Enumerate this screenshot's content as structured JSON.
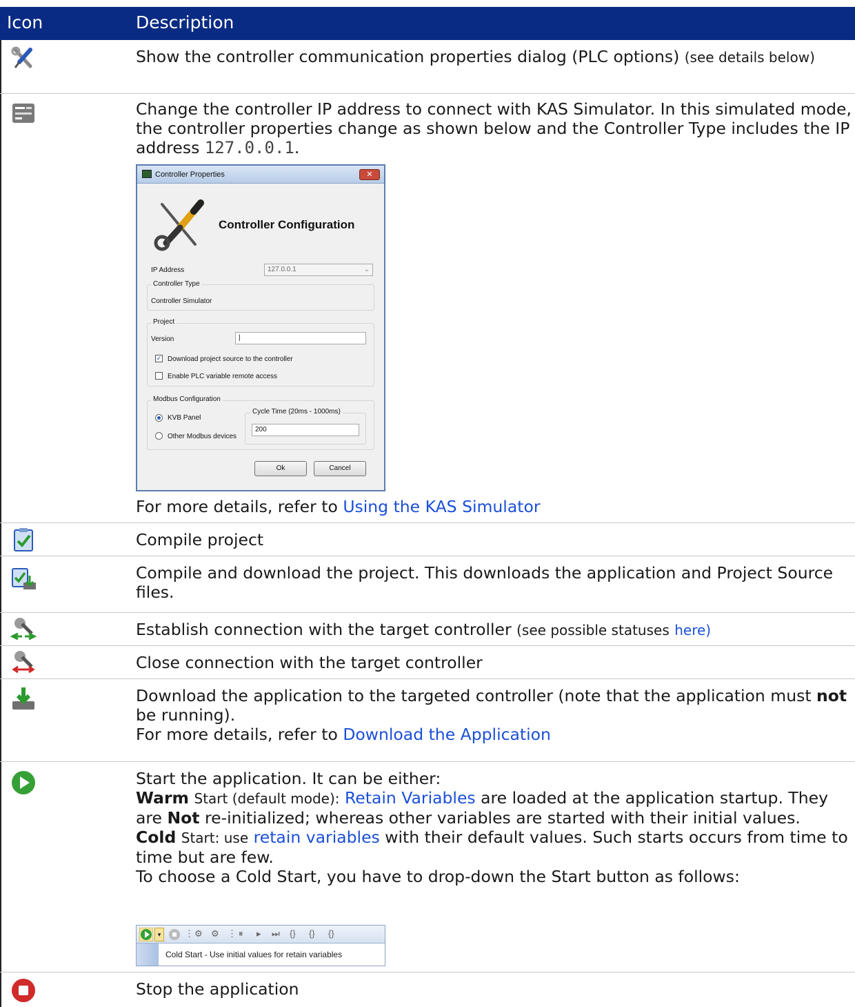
{
  "header": {
    "icon_col": "Icon",
    "desc_col": "Description"
  },
  "rows": {
    "r1": {
      "text": "Show the controller communication properties dialog (PLC options)",
      "small": "(see details below)"
    },
    "r2": {
      "text": "Change the controller IP address to connect with KAS Simulator. In this simulated mode, the controller properties change as shown below and the Controller Type includes the IP address",
      "ip": "127.0.0.1",
      "after": ".",
      "more_prefix": "For more details, refer to",
      "more_link": "Using the KAS Simulator"
    },
    "r3": {
      "text": "Compile project"
    },
    "r4": {
      "text": "Compile and download the project. This downloads the application and Project Source files."
    },
    "r5": {
      "text": "Establish connection with the target controller",
      "small": "(see possible statuses",
      "link": "here)"
    },
    "r6": {
      "text": "Close connection with the target controller"
    },
    "r7": {
      "text_a": "Download the application to the targeted controller (note that the application must",
      "bold": "not",
      "text_b": "be running).",
      "more_prefix": "For more details, refer to",
      "more_link": "Download the Application"
    },
    "r8": {
      "line1": "Start the application. It can be either:",
      "warm_bold": "Warm",
      "warm_small": "Start (default mode):",
      "warm_link": "Retain Variables",
      "warm_rest": "are loaded at the application startup. They are",
      "not_bold": "Not",
      "not_rest": "re-initialized; whereas other variables are started with their initial values.",
      "cold_bold": "Cold",
      "cold_small": "Start: use",
      "cold_link": "retain variables",
      "cold_rest": "with their default values. Such starts occurs from time to time but are few.",
      "choose": "To choose a Cold Start, you have to drop-down the Start button as follows:"
    },
    "r9": {
      "text": "Stop the application"
    }
  },
  "dialog": {
    "title": "Controller Properties",
    "close": "✕",
    "heading": "Controller Configuration",
    "ip_label": "IP Address",
    "ip_value": "127.0.0.1",
    "type_group": "Controller Type",
    "type_value": "Controller Simulator",
    "project_group": "Project",
    "version_label": "Version",
    "version_value": "|",
    "chk1": "Download project source to the controller",
    "chk1_checked": true,
    "chk2": "Enable PLC variable remote access",
    "chk2_checked": false,
    "modbus_group": "Modbus Configuration",
    "radio1": "KVB Panel",
    "radio2": "Other Modbus devices",
    "cycle_group": "Cycle Time (20ms - 1000ms)",
    "cycle_value": "200",
    "ok": "Ok",
    "cancel": "Cancel"
  },
  "toolbar": {
    "menu_item": "Cold Start - Use initial values for retain variables"
  },
  "colors": {
    "header_bg": "#0a2b84",
    "link": "#1a4fd8"
  }
}
